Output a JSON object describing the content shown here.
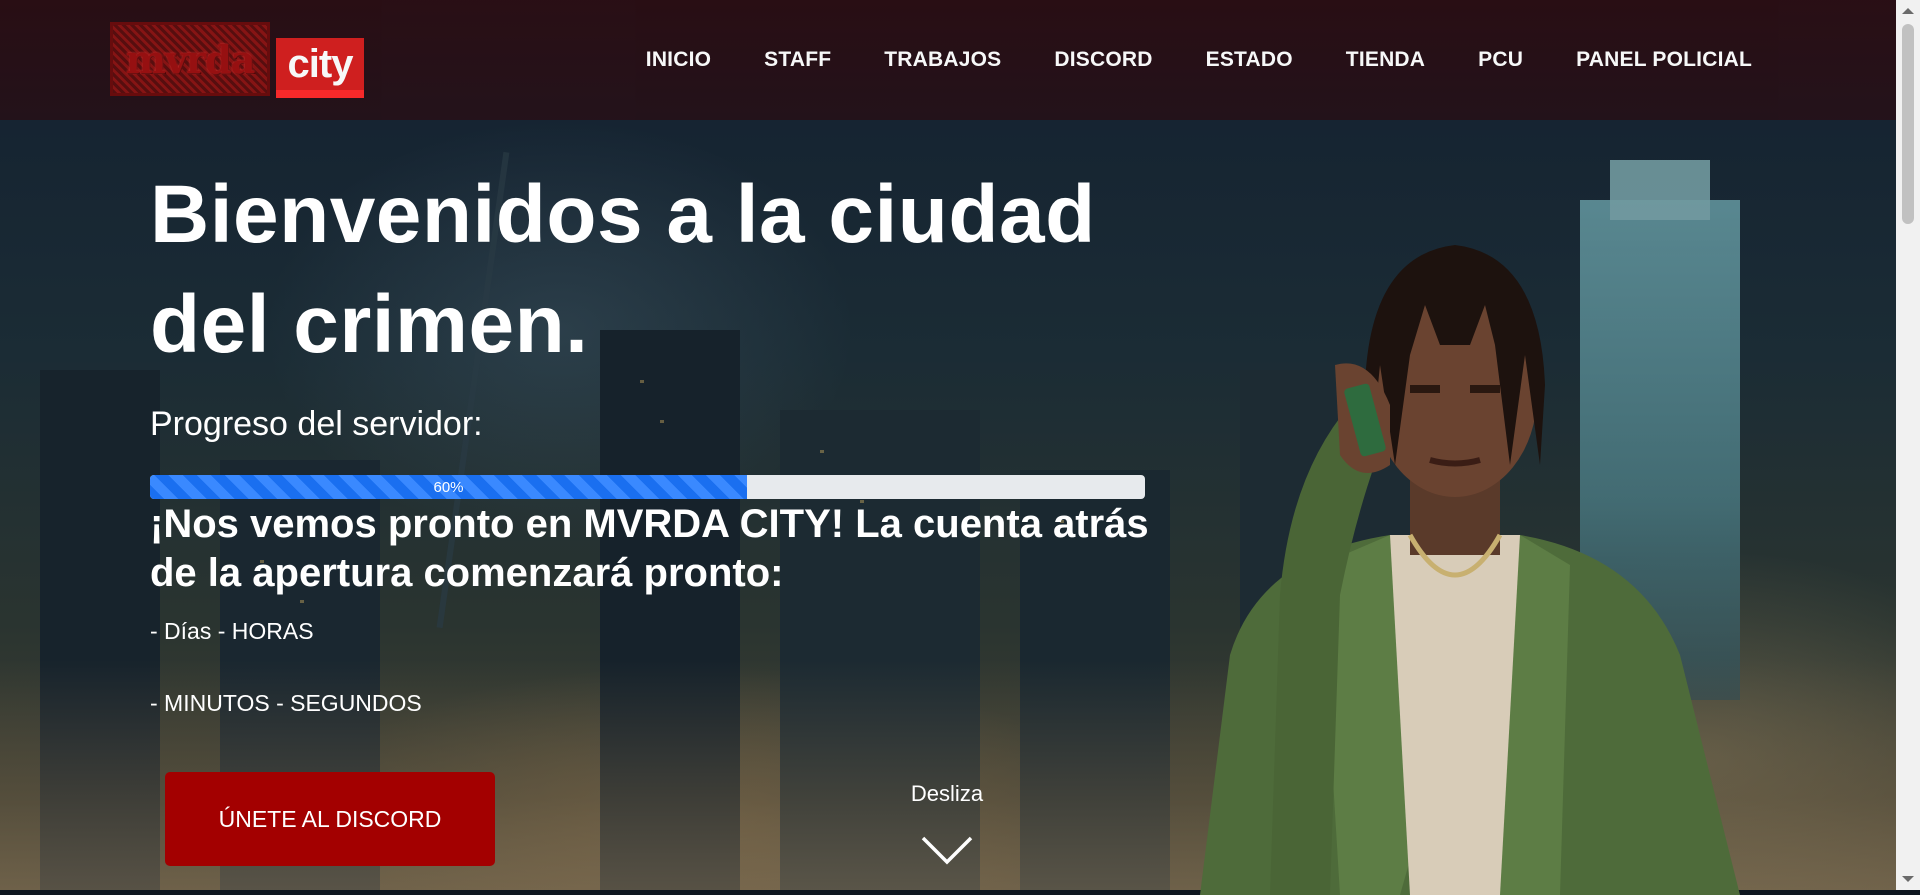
{
  "brand": {
    "logo_left_text": "mvrda",
    "logo_right_text": "city"
  },
  "nav": {
    "items": [
      {
        "label": "INICIO"
      },
      {
        "label": "STAFF"
      },
      {
        "label": "TRABAJOS"
      },
      {
        "label": "DISCORD"
      },
      {
        "label": "ESTADO"
      },
      {
        "label": "TIENDA"
      },
      {
        "label": "PCU"
      },
      {
        "label": "PANEL POLICIAL"
      }
    ]
  },
  "hero": {
    "title_line1": "Bienvenidos a la ciudad",
    "title_line2": "del crimen.",
    "progress_label": "Progreso del servidor:",
    "progress_value": 60,
    "progress_text": "60%",
    "announcement": "¡Nos vemos pronto en MVRDA CITY! La cuenta atrás de la apertura comenzará pronto:",
    "countdown_line1": "- Días - HORAS",
    "countdown_line2": "- MINUTOS - SEGUNDOS",
    "cta_label": "ÚNETE AL DISCORD",
    "scroll_hint": "Desliza"
  },
  "colors": {
    "nav_bg": "#26101a",
    "cta_bg": "#a30000",
    "progress_fill": "#1a6ff0",
    "progress_track": "#e7eaed"
  },
  "icons": {
    "scroll": "chevron-down-icon",
    "hero_image": "character-illustration"
  }
}
